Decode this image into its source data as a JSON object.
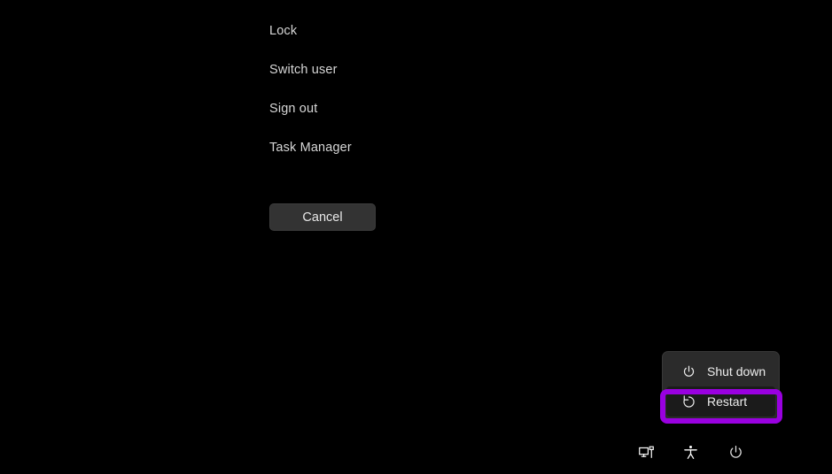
{
  "screen": {
    "background_color": "#000000",
    "type": "windows-security-screen"
  },
  "security_options": {
    "items": [
      {
        "label": "Lock"
      },
      {
        "label": "Switch user"
      },
      {
        "label": "Sign out"
      },
      {
        "label": "Task Manager"
      }
    ],
    "cancel_label": "Cancel"
  },
  "power_flyout": {
    "items": [
      {
        "label": "Shut down",
        "icon": "power-icon",
        "highlighted": false
      },
      {
        "label": "Restart",
        "icon": "restart-icon",
        "highlighted": true
      }
    ],
    "background_color": "#2b2b2b",
    "highlight_color": "#9900e0"
  },
  "tray": {
    "items": [
      {
        "icon": "network-icon"
      },
      {
        "icon": "accessibility-icon"
      },
      {
        "icon": "power-icon"
      }
    ]
  }
}
